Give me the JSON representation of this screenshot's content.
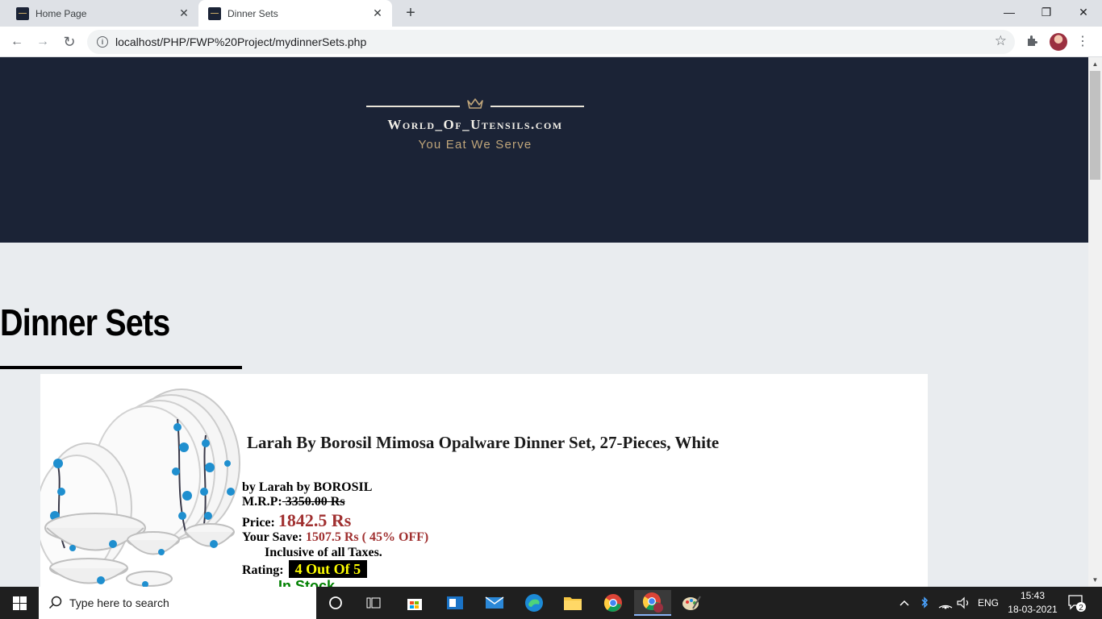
{
  "browser": {
    "tabs": [
      {
        "title": "Home Page",
        "close": "✕"
      },
      {
        "title": "Dinner Sets",
        "close": "✕"
      }
    ],
    "new_tab": "+",
    "window_controls": {
      "minimize": "—",
      "maximize": "❐",
      "close": "✕"
    },
    "url": "localhost/PHP/FWP%20Project/mydinnerSets.php",
    "nav": {
      "back": "←",
      "forward": "→",
      "reload": "↻"
    },
    "star": "☆",
    "menu": "⋮"
  },
  "site": {
    "brand": "World_Of_Utensils.com",
    "tagline": "You Eat We Serve",
    "colors": {
      "banner": "#1b2336",
      "gold": "#bfa57a"
    }
  },
  "page": {
    "heading": "Dinner Sets"
  },
  "product": {
    "title": "Larah By Borosil Mimosa Opalware Dinner Set, 27-Pieces, White",
    "brand_line": "by Larah by BOROSIL",
    "mrp_label": "M.R.P:",
    "mrp_value": " 3350.00 Rs",
    "price_label": "Price:",
    "price_value": "1842.5 Rs",
    "save_label": "Your Save:",
    "save_value": "1507.5 Rs ( 45% OFF)",
    "taxes": "Inclusive of all Taxes.",
    "rating_label": "Rating:",
    "rating_value": "4 Out Of 5",
    "stock": "In Stock"
  },
  "taskbar": {
    "search_placeholder": "Type here to search",
    "language": "ENG",
    "time": "15:43",
    "date": "18-03-2021",
    "notifications": "2"
  }
}
